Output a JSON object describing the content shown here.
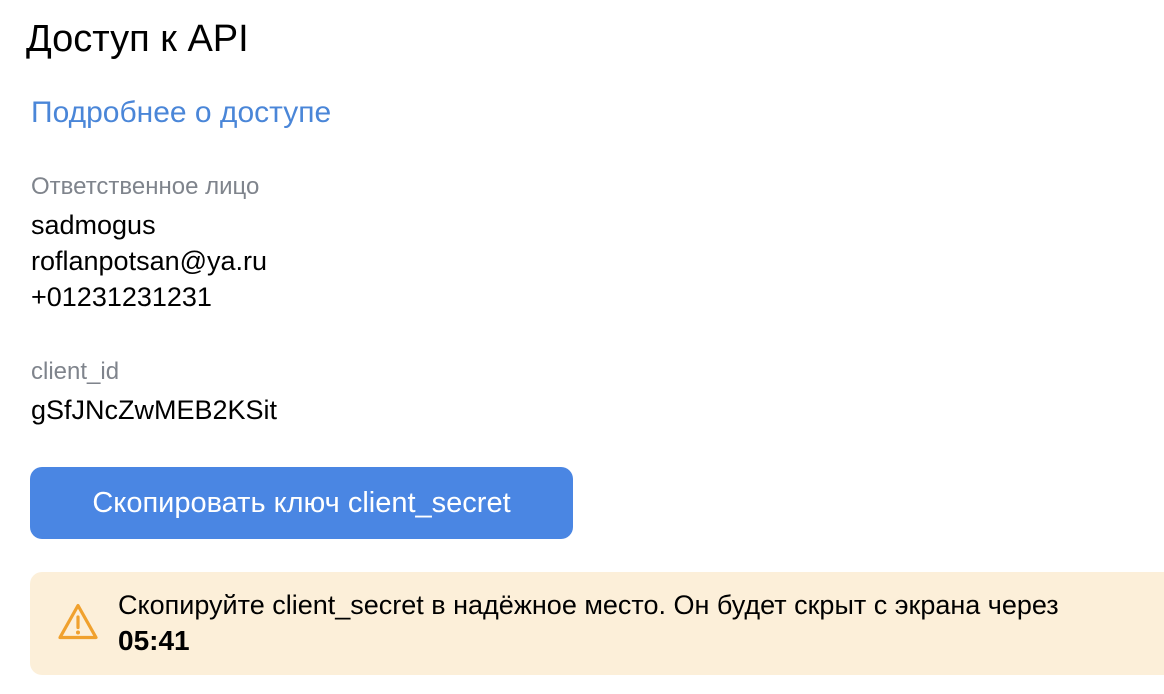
{
  "page": {
    "title": "Доступ к API",
    "access_link": "Подробнее о доступе"
  },
  "responsible": {
    "label": "Ответственное лицо",
    "name": "sadmogus",
    "email": "roflanpotsan@ya.ru",
    "phone": "+01231231231"
  },
  "client": {
    "id_label": "client_id",
    "id_value": "gSfJNcZwMEB2KSit"
  },
  "actions": {
    "copy_secret_label": "Скопировать ключ client_secret"
  },
  "warning": {
    "icon": "warning-triangle-icon",
    "message": "Скопируйте client_secret в надёжное место. Он будет скрыт с экрана через",
    "timer": "05:41"
  },
  "colors": {
    "link": "#4a86d8",
    "button": "#4a86e3",
    "warning_background": "#fcefd9",
    "warning_icon": "#f0a12e",
    "label": "#7f848c"
  }
}
